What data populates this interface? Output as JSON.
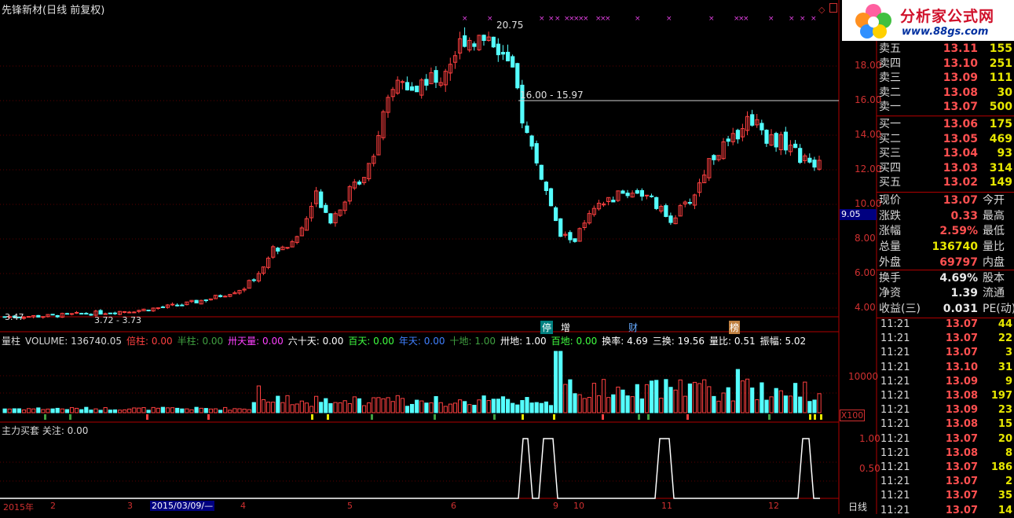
{
  "title": "先锋新材(日线 前复权)",
  "logo": {
    "brand": "分析家公式网",
    "url": "www.88gs.com"
  },
  "price_axis": [
    "18.00",
    "16.00",
    "14.00",
    "12.00",
    "10.00",
    "8.00",
    "6.00",
    "4.00"
  ],
  "price_axis_top": "2",
  "current_price_tag": "9.05",
  "annotations": {
    "high": "20.75",
    "low": "3.47",
    "low_range": "3.72 - 3.73",
    "level": "16.00 - 15.97"
  },
  "event_markers": [
    "停",
    "增",
    "财",
    "龙虎榜"
  ],
  "event_marker_short": [
    "停",
    "增",
    "财",
    "榜"
  ],
  "order_book": {
    "sell": [
      {
        "label": "卖五",
        "price": "13.11",
        "vol": "155"
      },
      {
        "label": "卖四",
        "price": "13.10",
        "vol": "251"
      },
      {
        "label": "卖三",
        "price": "13.09",
        "vol": "111"
      },
      {
        "label": "卖二",
        "price": "13.08",
        "vol": "30"
      },
      {
        "label": "卖一",
        "price": "13.07",
        "vol": "500"
      }
    ],
    "buy": [
      {
        "label": "买一",
        "price": "13.06",
        "vol": "175"
      },
      {
        "label": "买二",
        "price": "13.05",
        "vol": "469"
      },
      {
        "label": "买三",
        "price": "13.04",
        "vol": "93"
      },
      {
        "label": "买四",
        "price": "13.03",
        "vol": "314"
      },
      {
        "label": "买五",
        "price": "13.02",
        "vol": "149"
      }
    ]
  },
  "stats": [
    {
      "label": "现价",
      "value": "13.07",
      "right": "今开"
    },
    {
      "label": "涨跌",
      "value": "0.33",
      "right": "最高"
    },
    {
      "label": "涨幅",
      "value": "2.59%",
      "right": "最低"
    },
    {
      "label": "总量",
      "value": "136740",
      "right": "量比"
    },
    {
      "label": "外盘",
      "value": "69797",
      "right": "内盘"
    },
    {
      "label": "换手",
      "value": "4.69%",
      "right": "股本"
    },
    {
      "label": "净资",
      "value": "1.39",
      "right": "流通"
    },
    {
      "label": "收益(三)",
      "value": "0.031",
      "right": "PE(动)"
    }
  ],
  "ticks": [
    {
      "time": "11:21",
      "price": "13.07",
      "vol": "44"
    },
    {
      "time": "11:21",
      "price": "13.07",
      "vol": "22"
    },
    {
      "time": "11:21",
      "price": "13.07",
      "vol": "3"
    },
    {
      "time": "11:21",
      "price": "13.10",
      "vol": "31"
    },
    {
      "time": "11:21",
      "price": "13.09",
      "vol": "9"
    },
    {
      "time": "11:21",
      "price": "13.08",
      "vol": "197"
    },
    {
      "time": "11:21",
      "price": "13.09",
      "vol": "23"
    },
    {
      "time": "11:21",
      "price": "13.08",
      "vol": "15"
    },
    {
      "time": "11:21",
      "price": "13.07",
      "vol": "20"
    },
    {
      "time": "11:21",
      "price": "13.08",
      "vol": "8"
    },
    {
      "time": "11:21",
      "price": "13.07",
      "vol": "186"
    },
    {
      "time": "11:21",
      "price": "13.07",
      "vol": "2"
    },
    {
      "time": "11:21",
      "price": "13.07",
      "vol": "35"
    },
    {
      "time": "11:21",
      "price": "13.07",
      "vol": "14"
    }
  ],
  "volume_header": [
    {
      "text": "量柱",
      "color": "#d8d8d8"
    },
    {
      "text": "VOLUME: 136740.05",
      "color": "#d8d8d8"
    },
    {
      "text": "倍柱: 0.00",
      "color": "#ff4040"
    },
    {
      "text": "半柱: 0.00",
      "color": "#40a040"
    },
    {
      "text": "卅天量: 0.00",
      "color": "#ff40ff"
    },
    {
      "text": "六十天: 0.00",
      "color": "#ffffff"
    },
    {
      "text": "百天: 0.00",
      "color": "#40ff40"
    },
    {
      "text": "年天: 0.00",
      "color": "#4080ff"
    },
    {
      "text": "十地: 1.00",
      "color": "#40a040"
    },
    {
      "text": "卅地: 1.00",
      "color": "#ffffff"
    },
    {
      "text": "百地: 0.00",
      "color": "#40ff40"
    },
    {
      "text": "换率: 4.69",
      "color": "#ffffff"
    },
    {
      "text": "三换: 19.56",
      "color": "#ffffff"
    },
    {
      "text": "量比: 0.51",
      "color": "#ffffff"
    },
    {
      "text": "振幅: 5.02",
      "color": "#ffffff"
    }
  ],
  "volume_axis": {
    "label": "10000",
    "unit": "X100"
  },
  "indicator": {
    "label": "主力买套  关注: 0.00",
    "axis": [
      "1.00",
      "0.50"
    ]
  },
  "date_axis": [
    "2015年",
    "2",
    "3",
    "2015/03/09/—",
    "4",
    "5",
    "6",
    "9",
    "10",
    "11",
    "12"
  ],
  "period": "日线",
  "colors": {
    "up": "#ff4040",
    "down": "#54ffff",
    "grid": "#800000",
    "axis": "#b00000"
  }
}
